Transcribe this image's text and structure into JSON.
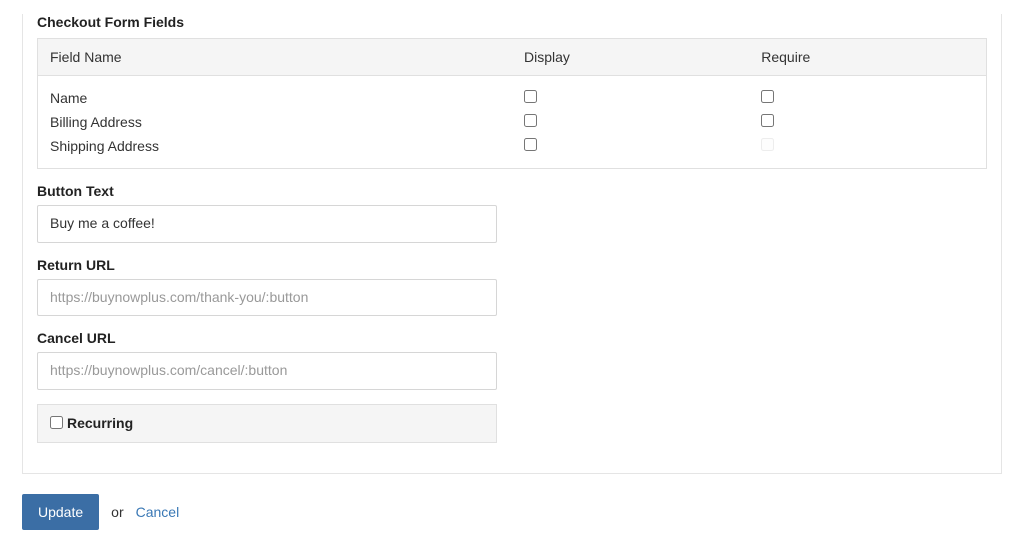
{
  "checkout_fields": {
    "heading": "Checkout Form Fields",
    "columns": {
      "name": "Field Name",
      "display": "Display",
      "require": "Require"
    },
    "rows": [
      {
        "label": "Name",
        "display": false,
        "require": false,
        "require_disabled": false
      },
      {
        "label": "Billing Address",
        "display": false,
        "require": false,
        "require_disabled": false
      },
      {
        "label": "Shipping Address",
        "display": false,
        "require": false,
        "require_disabled": true
      }
    ]
  },
  "button_text": {
    "label": "Button Text",
    "value": "Buy me a coffee!"
  },
  "return_url": {
    "label": "Return URL",
    "value": "",
    "placeholder": "https://buynowplus.com/thank-you/:button"
  },
  "cancel_url": {
    "label": "Cancel URL",
    "value": "",
    "placeholder": "https://buynowplus.com/cancel/:button"
  },
  "recurring": {
    "label": "Recurring",
    "checked": false
  },
  "actions": {
    "update": "Update",
    "or": "or",
    "cancel": "Cancel"
  }
}
